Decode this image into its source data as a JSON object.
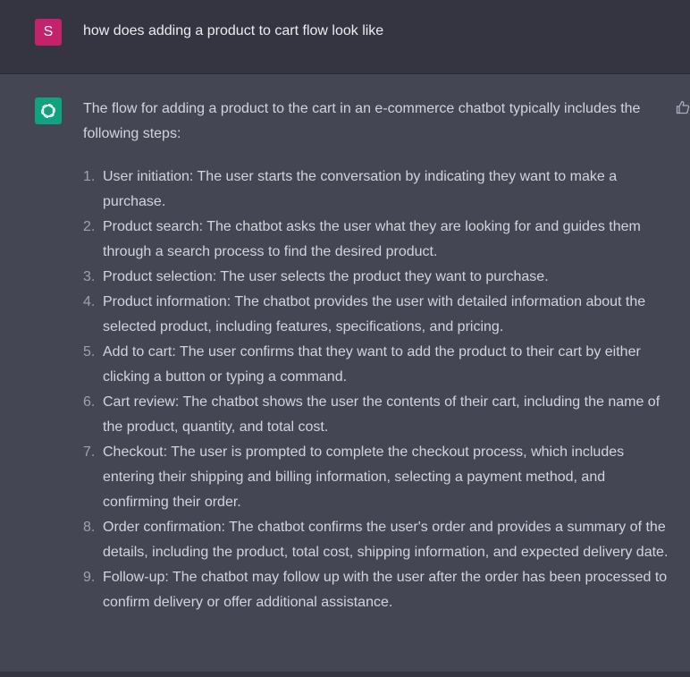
{
  "user_message": {
    "avatar_letter": "S",
    "text": "how does adding a product to cart flow look like"
  },
  "assistant_message": {
    "intro": "The flow for adding a product to the cart in an e-commerce chatbot typically includes the following steps:",
    "items": [
      {
        "num": "1.",
        "text": "User initiation: The user starts the conversation by indicating they want to make a purchase."
      },
      {
        "num": "2.",
        "text": "Product search: The chatbot asks the user what they are looking for and guides them through a search process to find the desired product."
      },
      {
        "num": "3.",
        "text": "Product selection: The user selects the product they want to purchase."
      },
      {
        "num": "4.",
        "text": "Product information: The chatbot provides the user with detailed information about the selected product, including features, specifications, and pricing."
      },
      {
        "num": "5.",
        "text": "Add to cart: The user confirms that they want to add the product to their cart by either clicking a button or typing a command."
      },
      {
        "num": "6.",
        "text": "Cart review: The chatbot shows the user the contents of their cart, including the name of the product, quantity, and total cost."
      },
      {
        "num": "7.",
        "text": "Checkout: The user is prompted to complete the checkout process, which includes entering their shipping and billing information, selecting a payment method, and confirming their order."
      },
      {
        "num": "8.",
        "text": "Order confirmation: The chatbot confirms the user's order and provides a summary of the details, including the product, total cost, shipping information, and expected delivery date."
      },
      {
        "num": "9.",
        "text": "Follow-up: The chatbot may follow up with the user after the order has been processed to confirm delivery or offer additional assistance."
      }
    ]
  },
  "colors": {
    "user_avatar": "#c4236b",
    "assistant_avatar": "#10a37f",
    "user_row_bg": "#343541",
    "assistant_row_bg": "#444654"
  },
  "icons": {
    "assistant_avatar": "openai-logo-icon",
    "feedback": "thumbs-up-icon"
  }
}
